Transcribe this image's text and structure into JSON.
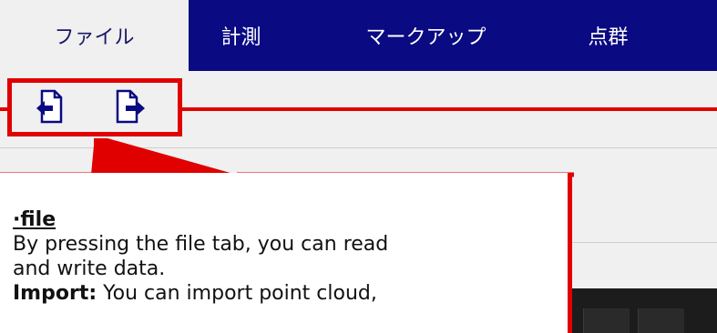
{
  "menubar": {
    "tabs": [
      {
        "label": "ファイル"
      },
      {
        "label": "計測"
      },
      {
        "label": "マークアップ"
      },
      {
        "label": "点群"
      }
    ]
  },
  "ribbon": {
    "import_icon": "file-import-icon",
    "export_icon": "file-export-icon"
  },
  "callout": {
    "heading": "·file",
    "body": "By pressing the file tab, you can read\nand write data.",
    "import_label": "Import:",
    "import_text": " You can import point cloud,"
  },
  "colors": {
    "menubar": "#0a0a82",
    "highlight": "#e00000"
  }
}
